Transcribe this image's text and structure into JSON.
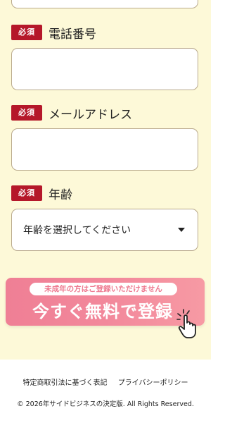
{
  "form": {
    "phone": {
      "badge": "必須",
      "label": "電話番号",
      "value": "",
      "placeholder": ""
    },
    "email": {
      "badge": "必須",
      "label": "メールアドレス",
      "value": "",
      "placeholder": ""
    },
    "age": {
      "badge": "必須",
      "label": "年齢",
      "selected": "年齢を選択してください"
    }
  },
  "cta": {
    "sub_text": "未成年の方はご登録いただけません",
    "main_text": "今すぐ無料で登録",
    "icon": "hand-pointer-icon"
  },
  "footer": {
    "links": [
      "特定商取引法に基づく表記",
      "プライバシーポリシー"
    ],
    "copyright": "© 2026年サイドビジネスの決定版. All Rights Reserved."
  },
  "colors": {
    "form_background": "#fdf9d8",
    "required_badge": "#b5182a",
    "input_border": "#b9a98c",
    "cta_gradient_start": "#ef7f95",
    "cta_gradient_end": "#f79aa4"
  }
}
